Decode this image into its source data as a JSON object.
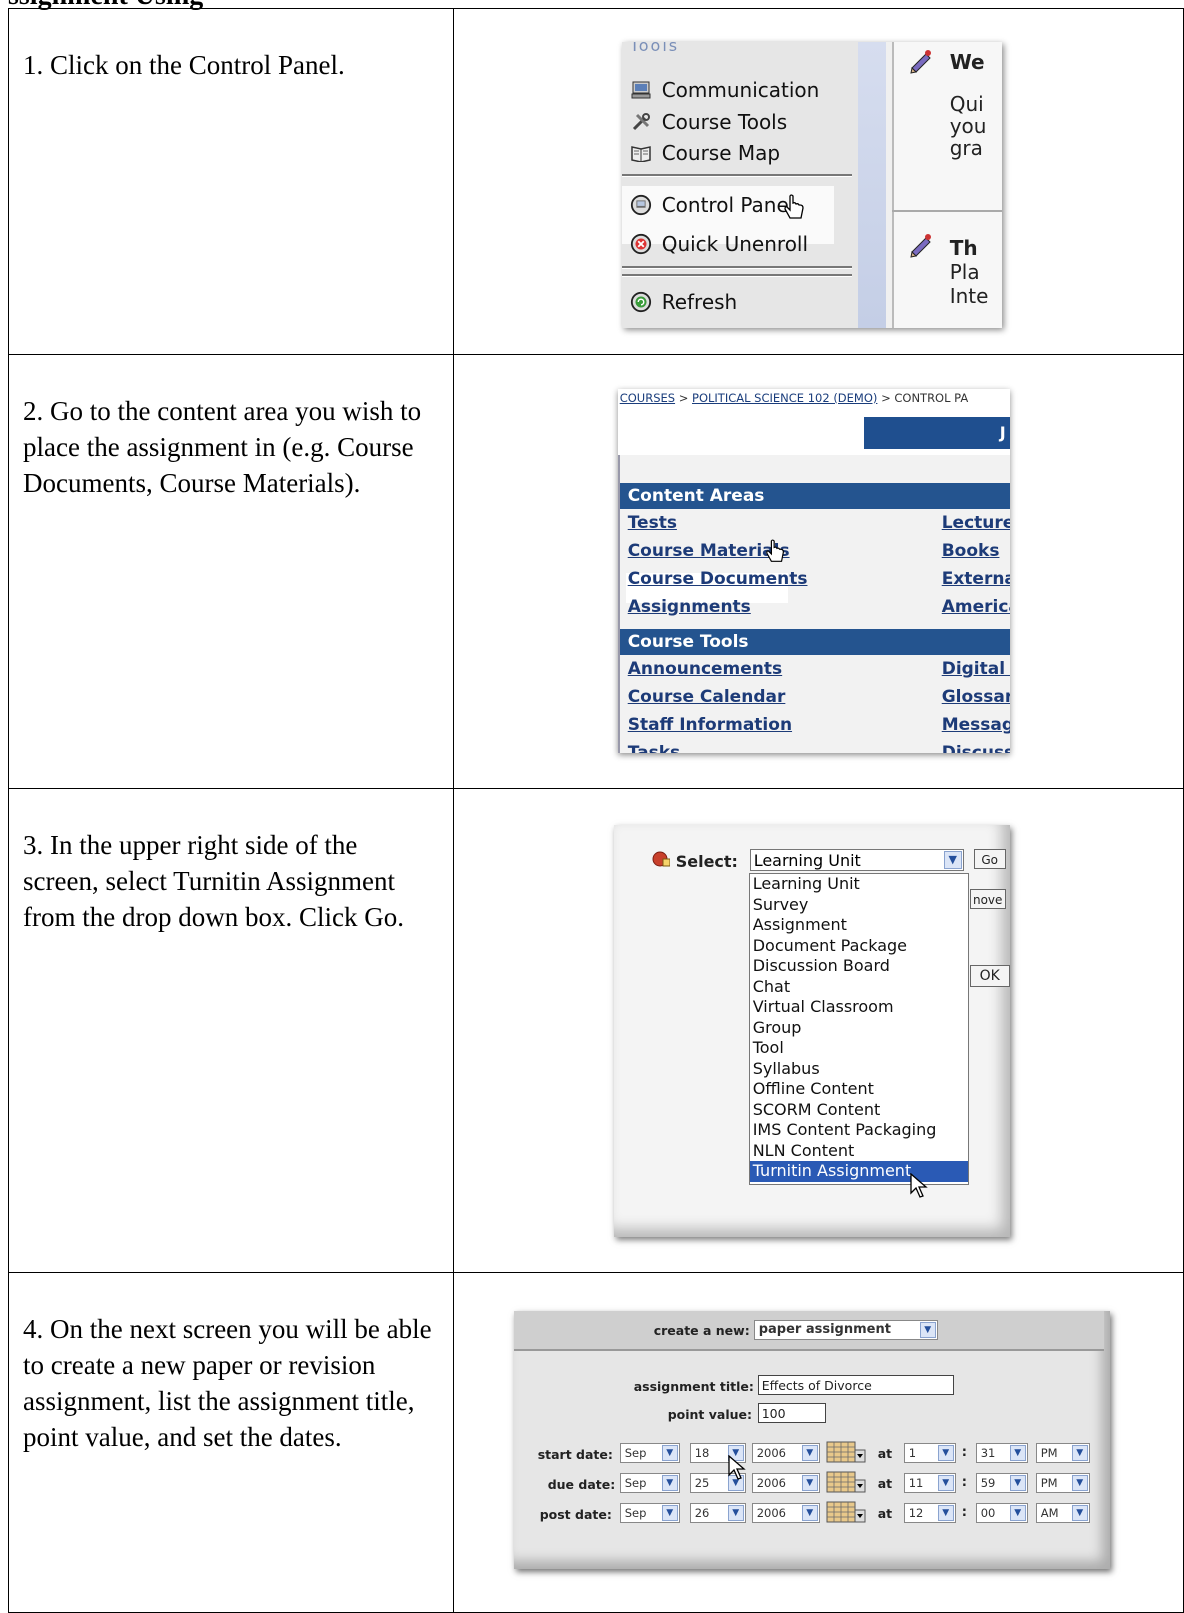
{
  "heading_fragment": "ssignment Using",
  "steps": [
    {
      "text": "1. Click on the Control Panel."
    },
    {
      "text": "2. Go to the content area you wish to place the assignment in (e.g. Course Documents, Course Materials)."
    },
    {
      "text": "3. In the upper right side of the screen, select Turnitin Assignment from the drop down box. Click Go."
    },
    {
      "text": "4. On the next screen you will be able to create a new paper or revision assignment, list the assignment title, point value, and set the dates."
    }
  ],
  "shot1": {
    "menu_header": "Tools",
    "items": [
      "Communication",
      "Course Tools",
      "Course Map",
      "Control Panel",
      "Quick Unenroll",
      "Refresh"
    ],
    "right_pane": {
      "line1": "We",
      "line2": "Qui",
      "line3": "you",
      "line4": "gra",
      "line5": "Th",
      "line6": "Pla",
      "line7": "Inte"
    }
  },
  "shot2": {
    "breadcrumb": {
      "courses": "COURSES",
      "sep1": ">",
      "course": "POLITICAL SCIENCE 102 (DEMO)",
      "sep2": ">",
      "current": "CONTROL PA"
    },
    "header_right": "J",
    "content_areas": {
      "title": "Content Areas",
      "left": [
        "Tests",
        "Course Materials",
        "Course Documents",
        "Assignments"
      ],
      "right": [
        "Lecture",
        "Books",
        "Externa",
        "America"
      ]
    },
    "course_tools": {
      "title": "Course Tools",
      "left": [
        "Announcements",
        "Course Calendar",
        "Staff Information",
        "Tasks"
      ],
      "right": [
        "Digital I",
        "Glossar",
        "Messag",
        "Discussi"
      ]
    }
  },
  "shot3": {
    "select_label": "Select:",
    "selected_value": "Learning Unit",
    "go_label": "Go",
    "remove_label": "nove",
    "ok_label": "OK",
    "options": [
      "Learning Unit",
      "Survey",
      "Assignment",
      "Document Package",
      "Discussion Board",
      "Chat",
      "Virtual Classroom",
      "Group",
      "Tool",
      "Syllabus",
      "Offline Content",
      "SCORM Content",
      "IMS Content Packaging",
      "NLN Content",
      "Turnitin Assignment"
    ],
    "highlighted_option": "Turnitin Assignment"
  },
  "shot4": {
    "create_label": "create a new:",
    "create_value": "paper assignment",
    "title_label": "assignment title:",
    "title_value": "Effects of Divorce",
    "points_label": "point value:",
    "points_value": "100",
    "at_label": "at",
    "colon": ":",
    "dates": [
      {
        "label": "start date:",
        "month": "Sep",
        "day": "18",
        "year": "2006",
        "hour": "1",
        "minute": "31",
        "ampm": "PM"
      },
      {
        "label": "due date:",
        "month": "Sep",
        "day": "25",
        "year": "2006",
        "hour": "11",
        "minute": "59",
        "ampm": "PM"
      },
      {
        "label": "post date:",
        "month": "Sep",
        "day": "26",
        "year": "2006",
        "hour": "12",
        "minute": "00",
        "ampm": "AM"
      }
    ]
  }
}
